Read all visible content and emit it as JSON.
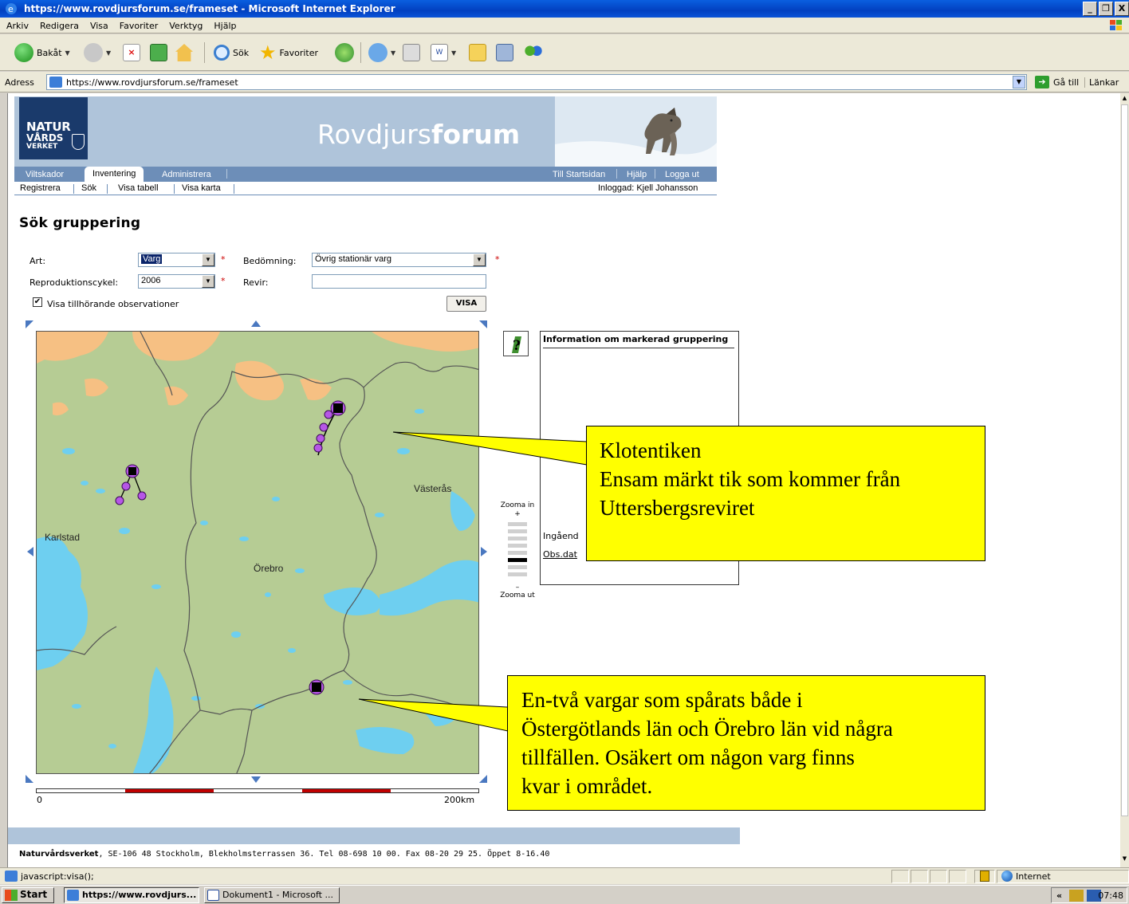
{
  "window": {
    "title": "https://www.rovdjursforum.se/frameset - Microsoft Internet Explorer",
    "buttons": [
      "_",
      "❐",
      "X"
    ]
  },
  "menu": [
    "Arkiv",
    "Redigera",
    "Visa",
    "Favoriter",
    "Verktyg",
    "Hjälp"
  ],
  "toolbar": {
    "back_label": "Bakåt",
    "search_label": "Sök",
    "favorites_label": "Favoriter"
  },
  "address": {
    "label": "Adress",
    "url": "https://www.rovdjursforum.se/frameset",
    "go_label": "Gå till",
    "links_label": "Länkar"
  },
  "site": {
    "logo": {
      "line1": "NATUR",
      "line2": "VÅRDS",
      "line3": "VERKET"
    },
    "title_light": "Rovdjurs",
    "title_bold": "forum",
    "nav_tabs": [
      "Viltskador",
      "Inventering",
      "Administrera"
    ],
    "nav_right": [
      "Till Startsidan",
      "Hjälp",
      "Logga ut"
    ],
    "sub_nav": [
      "Registrera",
      "Sök",
      "Visa tabell",
      "Visa karta"
    ],
    "logged_in": "Inloggad: Kjell Johansson"
  },
  "form": {
    "page_title": "Sök gruppering",
    "art_label": "Art:",
    "art_value": "Varg",
    "bedomning_label": "Bedömning:",
    "bedomning_value": "Övrig stationär varg",
    "repro_label": "Reproduktionscykel:",
    "repro_value": "2006",
    "revir_label": "Revir:",
    "revir_value": "",
    "required_mark": "*",
    "show_obs_label": "Visa tillhörande observationer",
    "show_obs_checked": true,
    "visa_button": "VISA"
  },
  "map": {
    "place_labels": [
      "Karlstad",
      "Örebro",
      "Västerås"
    ],
    "scale_start": "0",
    "scale_end": "200km",
    "zoom_in_label": "Zooma in",
    "zoom_in_sign": "+",
    "zoom_out_sign": "–",
    "zoom_out_label": "Zooma ut",
    "zoom_levels": 8,
    "zoom_selected_level": 5
  },
  "info": {
    "header": "Information om markerad gruppering",
    "row1": "Ingåend",
    "row2": "Obs.dat"
  },
  "callouts": {
    "first": [
      "Klotentiken",
      "Ensam märkt tik som kommer från",
      "Uttersbergsreviret"
    ],
    "second": [
      "En-två vargar som spårats både i",
      "Östergötlands län och Örebro län vid några",
      "tillfällen. Osäkert om någon varg finns",
      "kvar i området."
    ]
  },
  "footer": {
    "org": "Naturvårdsverket",
    "text": ", SE-106 48 Stockholm, Blekholmsterrassen 36. Tel 08-698 10 00. Fax 08-20 29 25. Öppet 8-16.40"
  },
  "status": {
    "text": "javascript:visa();",
    "zone": "Internet"
  },
  "taskbar": {
    "start": "Start",
    "tasks": [
      "https://www.rovdjurs...",
      "Dokument1 - Microsoft ..."
    ],
    "clock": "07:48",
    "tray_chevron": "«"
  },
  "colors": {
    "header_blue": "#afc4da",
    "nav_blue": "#6d8eb8",
    "map_land": "#b6cc94",
    "map_water": "#6ecff0",
    "map_urban": "#f6c083",
    "marker_purple": "#b657e6",
    "callout_yellow": "#ffff00"
  }
}
